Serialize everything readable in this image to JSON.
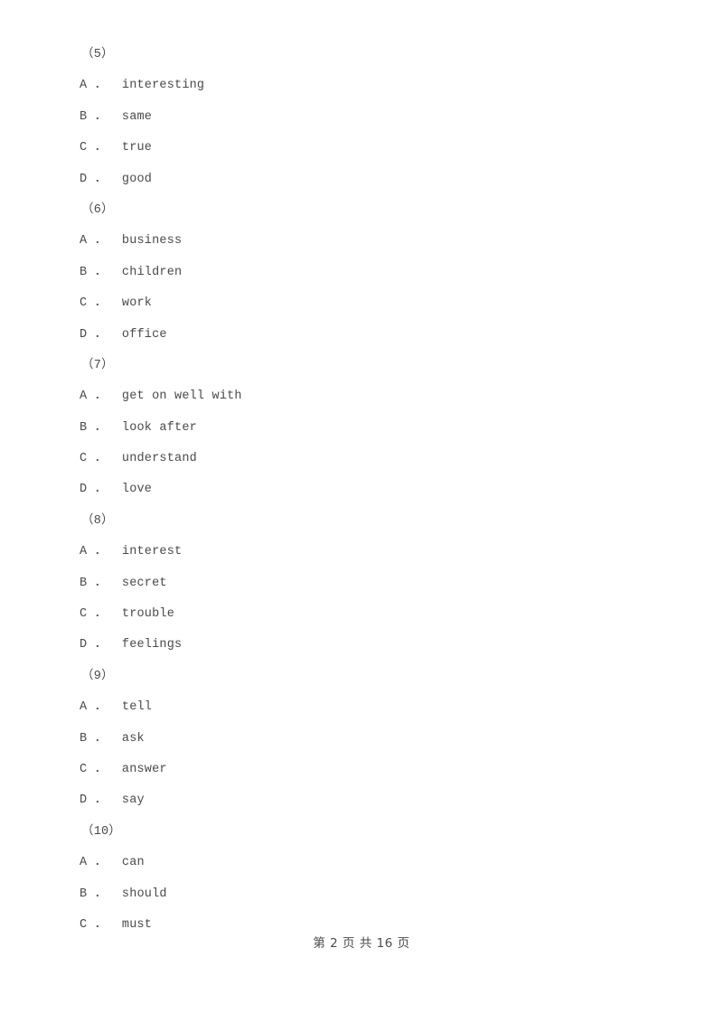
{
  "document": {
    "page_background": "#ffffff",
    "text_color": "#4a4a4a",
    "blocks": [
      {
        "number_label": "（5）",
        "options": [
          {
            "letter": "A",
            "separator": "．",
            "text": "interesting"
          },
          {
            "letter": "B",
            "separator": "．",
            "text": "same"
          },
          {
            "letter": "C",
            "separator": "．",
            "text": "true"
          },
          {
            "letter": "D",
            "separator": "．",
            "text": "good"
          }
        ]
      },
      {
        "number_label": "（6）",
        "options": [
          {
            "letter": "A",
            "separator": "．",
            "text": "business"
          },
          {
            "letter": "B",
            "separator": "．",
            "text": "children"
          },
          {
            "letter": "C",
            "separator": "．",
            "text": "work"
          },
          {
            "letter": "D",
            "separator": "．",
            "text": "office"
          }
        ]
      },
      {
        "number_label": "（7）",
        "options": [
          {
            "letter": "A",
            "separator": "．",
            "text": "get on well with"
          },
          {
            "letter": "B",
            "separator": "．",
            "text": "look after"
          },
          {
            "letter": "C",
            "separator": "．",
            "text": "understand"
          },
          {
            "letter": "D",
            "separator": "．",
            "text": "love"
          }
        ]
      },
      {
        "number_label": "（8）",
        "options": [
          {
            "letter": "A",
            "separator": "．",
            "text": "interest"
          },
          {
            "letter": "B",
            "separator": "．",
            "text": "secret"
          },
          {
            "letter": "C",
            "separator": "．",
            "text": "trouble"
          },
          {
            "letter": "D",
            "separator": "．",
            "text": "feelings"
          }
        ]
      },
      {
        "number_label": "（9）",
        "options": [
          {
            "letter": "A",
            "separator": "．",
            "text": "tell"
          },
          {
            "letter": "B",
            "separator": "．",
            "text": "ask"
          },
          {
            "letter": "C",
            "separator": "．",
            "text": "answer"
          },
          {
            "letter": "D",
            "separator": "．",
            "text": "say"
          }
        ]
      },
      {
        "number_label": "（10）",
        "options": [
          {
            "letter": "A",
            "separator": "．",
            "text": "can"
          },
          {
            "letter": "B",
            "separator": "．",
            "text": "should"
          },
          {
            "letter": "C",
            "separator": "．",
            "text": "must"
          }
        ]
      }
    ],
    "lines": [
      {
        "type": "qnum",
        "text": "（5）"
      },
      {
        "type": "opt",
        "text": "A ．  interesting"
      },
      {
        "type": "opt",
        "text": "B ．  same"
      },
      {
        "type": "opt",
        "text": "C ．  true"
      },
      {
        "type": "opt",
        "text": "D ．  good"
      },
      {
        "type": "qnum",
        "text": "（6）"
      },
      {
        "type": "opt",
        "text": "A ．  business"
      },
      {
        "type": "opt",
        "text": "B ．  children"
      },
      {
        "type": "opt",
        "text": "C ．  work"
      },
      {
        "type": "opt",
        "text": "D ．  office"
      },
      {
        "type": "qnum",
        "text": "（7）"
      },
      {
        "type": "opt",
        "text": "A ．  get on well with"
      },
      {
        "type": "opt",
        "text": "B ．  look after"
      },
      {
        "type": "opt",
        "text": "C ．  understand"
      },
      {
        "type": "opt",
        "text": "D ．  love"
      },
      {
        "type": "qnum",
        "text": "（8）"
      },
      {
        "type": "opt",
        "text": "A ．  interest"
      },
      {
        "type": "opt",
        "text": "B ．  secret"
      },
      {
        "type": "opt",
        "text": "C ．  trouble"
      },
      {
        "type": "opt",
        "text": "D ．  feelings"
      },
      {
        "type": "qnum",
        "text": "（9）"
      },
      {
        "type": "opt",
        "text": "A ．  tell"
      },
      {
        "type": "opt",
        "text": "B ．  ask"
      },
      {
        "type": "opt",
        "text": "C ．  answer"
      },
      {
        "type": "opt",
        "text": "D ．  say"
      },
      {
        "type": "qnum",
        "text": "（10）"
      },
      {
        "type": "opt",
        "text": "A ．  can"
      },
      {
        "type": "opt",
        "text": "B ．  should"
      },
      {
        "type": "opt",
        "text": "C ．  must"
      }
    ],
    "footer": {
      "text": "第 2 页 共 16 页",
      "current_page": "2",
      "total_pages": "16"
    }
  }
}
